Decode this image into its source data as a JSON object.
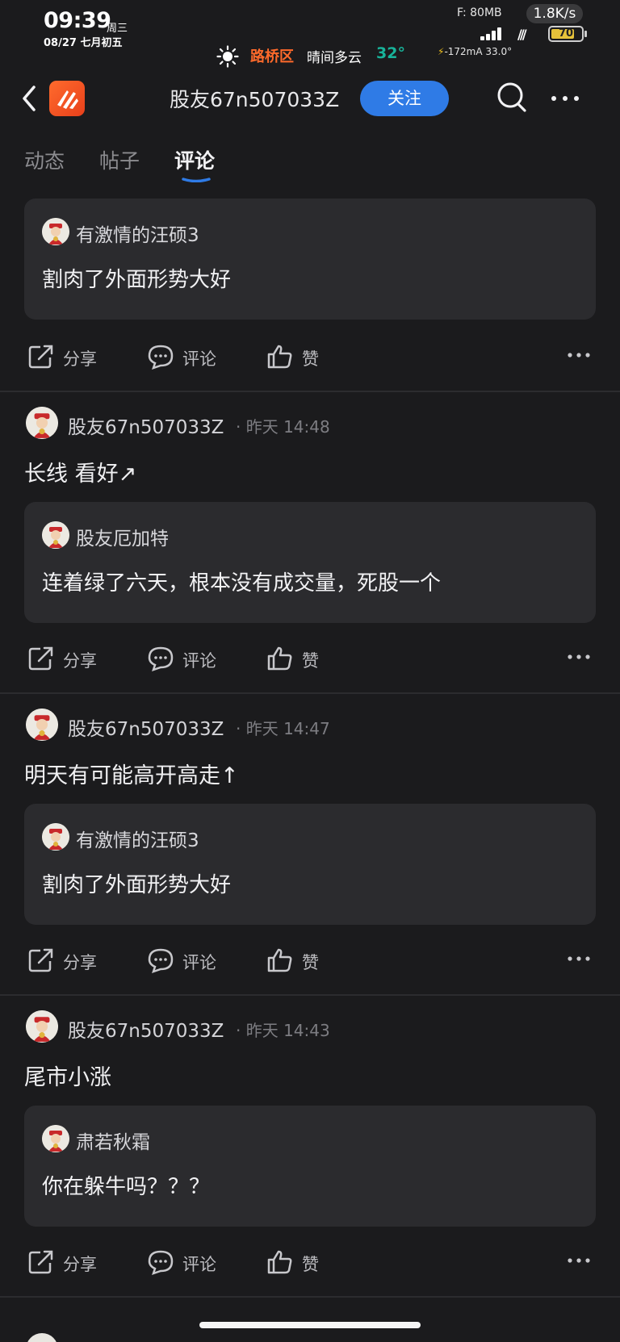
{
  "status_bar": {
    "time": "09:39",
    "weekday": "周三",
    "date": "08/27 七月初五",
    "district": "路桥区",
    "weather": "晴间多云",
    "temperature": "32°",
    "memory": "F: 80MB",
    "net_speed": "1.8K/s",
    "battery_level": "70",
    "charge_info": "-172mA 33.0°",
    "bolt": "⚡"
  },
  "header": {
    "profile_name": "股友67n507033Z",
    "follow_label": "关注"
  },
  "tabs": [
    "动态",
    "帖子",
    "评论"
  ],
  "active_tab": "评论",
  "colors": {
    "accent": "#2f7be6",
    "brand": "#ff6b2d",
    "background": "#1b1b1d",
    "quote_bg": "#2b2b2e",
    "temp": "#18b39a"
  },
  "icons": {
    "back": "chevron-left-icon",
    "search": "search-icon",
    "more": "more-dots-icon",
    "share": "share-icon",
    "comment": "comment-icon",
    "like": "thumbs-up-icon"
  },
  "actions": {
    "share": "分享",
    "comment": "评论",
    "like": "赞"
  },
  "posts": [
    {
      "quote_author": "有激情的汪硕3",
      "quote_text": "割肉了外面形势大好"
    },
    {
      "author": "股友67n507033Z",
      "meta": "· 昨天 14:48",
      "text": "长线 看好↗",
      "quote_author": "股友厄加特",
      "quote_text": "连着绿了六天，根本没有成交量，死股一个"
    },
    {
      "author": "股友67n507033Z",
      "meta": "· 昨天 14:47",
      "text": "明天有可能高开高走↑",
      "quote_author": "有激情的汪硕3",
      "quote_text": "割肉了外面形势大好"
    },
    {
      "author": "股友67n507033Z",
      "meta": "· 昨天 14:43",
      "text": "尾市小涨",
      "quote_author": "肃若秋霜",
      "quote_text": "你在躲牛吗？？？"
    }
  ]
}
